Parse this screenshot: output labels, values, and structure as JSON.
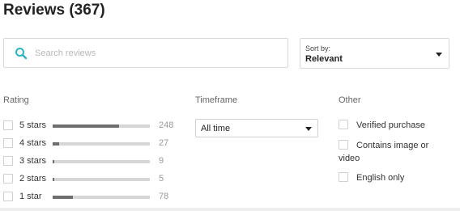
{
  "header": {
    "title": "Reviews (367)"
  },
  "search": {
    "placeholder": "Search reviews",
    "value": "",
    "icon": "search-icon",
    "icon_color": "#2bb3c0"
  },
  "sort": {
    "caption": "Sort by:",
    "value": "Relevant"
  },
  "filters": {
    "rating_label": "Rating",
    "timeframe_label": "Timeframe",
    "other_label": "Other",
    "ratings": [
      {
        "label": "5 stars",
        "count": "248",
        "fraction": 0.68
      },
      {
        "label": "4 stars",
        "count": "27",
        "fraction": 0.07
      },
      {
        "label": "3 stars",
        "count": "9",
        "fraction": 0.02
      },
      {
        "label": "2 stars",
        "count": "5",
        "fraction": 0.01
      },
      {
        "label": "1 star",
        "count": "78",
        "fraction": 0.21
      }
    ],
    "timeframe": {
      "value": "All time"
    },
    "other": [
      {
        "label": "Verified purchase"
      },
      {
        "label": "Contains image or",
        "label_cont": "video"
      },
      {
        "label": "English only"
      }
    ]
  },
  "colors": {
    "bar_fill": "#6e6e6e",
    "bar_track": "#d6d6d6",
    "search_icon": "#2bb3c0"
  }
}
